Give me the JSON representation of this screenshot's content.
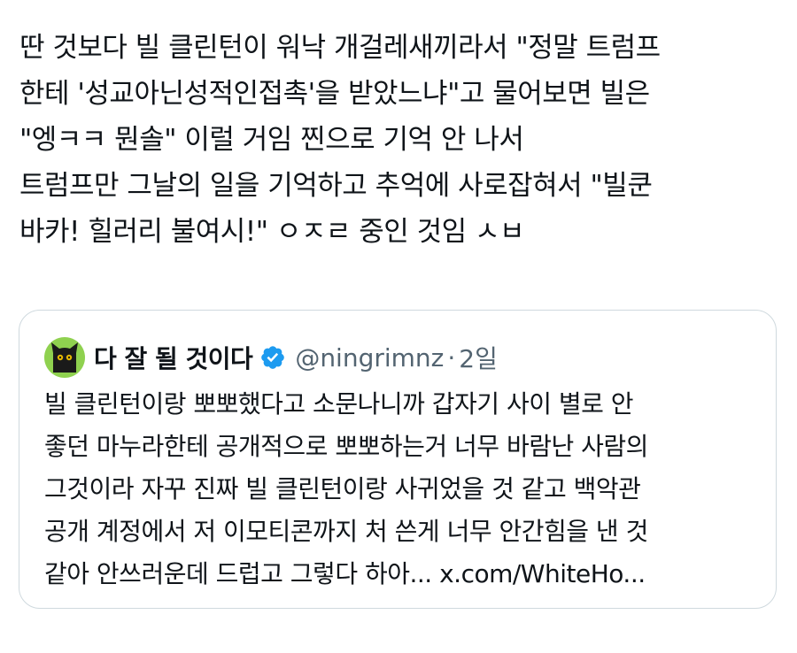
{
  "tweet": {
    "text_lines": [
      "딴 것보다 빌 클린턴이 워낙 개걸레새끼라서 \"정말 트럼프",
      "한테 '성교아닌성적인접촉'을 받았느냐\"고 물어보면 빌은",
      "\"엥ㅋㅋ 뭔솔\" 이럴 거임 찐으로 기억 안 나서",
      "트럼프만 그날의 일을 기억하고 추억에 사로잡혀서 \"빌쿤",
      "바카! 힐러리 불여시!\" ㅇㅈㄹ 중인 것임 ㅅㅂ"
    ]
  },
  "quoted_tweet": {
    "display_name": "다 잘 될 것이다",
    "handle": "@ningrimnz",
    "separator": "·",
    "timestamp": "2일",
    "avatar_icon": "black-cat-avatar-icon",
    "verified_icon": "verified-badge-icon",
    "colors": {
      "avatar_bg": "#8fd14f",
      "verified": "#1d9bf0",
      "secondary_text": "#536471",
      "border": "#cfd9de"
    },
    "text_lines": [
      "빌 클린턴이랑 뽀뽀했다고 소문나니까 갑자기 사이 별로 안",
      "좋던 마누라한테 공개적으로 뽀뽀하는거 너무 바람난 사람의",
      "그것이라 자꾸 진짜 빌 클린턴이랑 사귀었을 것 같고 백악관",
      "공개 계정에서 저 이모티콘까지 처 쓴게 너무 안간힘을 낸 것",
      "같아 안쓰러운데 드럽고 그렇다 하아... x.com/WhiteHo..."
    ]
  }
}
